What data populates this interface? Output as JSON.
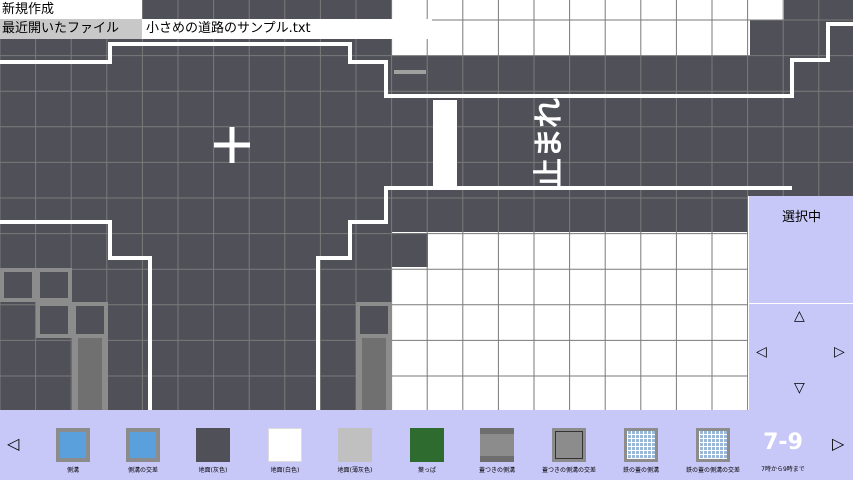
{
  "menu": {
    "new_file": "新規作成",
    "recent_files": "最近開いたファイル",
    "recent_file_name": "小さめの道路のサンプル.txt"
  },
  "map": {
    "road_marking": "止まれ",
    "colors": {
      "road": "#505058",
      "grid": "#7a7a7a",
      "white_line": "#ffffff",
      "ground_white": "#ffffff",
      "gutter": "#8c8c8c"
    }
  },
  "side_panel": {
    "title": "選択中",
    "up": "△",
    "left": "◁",
    "right": "▷",
    "down": "▽"
  },
  "palette": {
    "prev": "◁",
    "next": "▷",
    "items": [
      {
        "label": "側溝",
        "icon": "gutter-icon",
        "color": "#5aa0dc"
      },
      {
        "label": "側溝の交差",
        "icon": "gutter-cross-icon",
        "color": "#5aa0dc"
      },
      {
        "label": "地面(灰色)",
        "icon": "gray-ground-icon",
        "color": "#505058"
      },
      {
        "label": "地面(白色)",
        "icon": "white-ground-icon",
        "color": "#ffffff"
      },
      {
        "label": "地面(薄灰色)",
        "icon": "light-gray-ground-icon",
        "color": "#c0c0c0"
      },
      {
        "label": "葉っぱ",
        "icon": "leaf-icon",
        "color": "#2e6b2e"
      },
      {
        "label": "蓋つきの側溝",
        "icon": "covered-gutter-icon",
        "color": "#8c8c8c"
      },
      {
        "label": "蓋つきの側溝の交差",
        "icon": "covered-gutter-cross-icon",
        "color": "#8c8c8c"
      },
      {
        "label": "鉄の蓋の側溝",
        "icon": "iron-cover-gutter-icon",
        "color": "#9ab8d8"
      },
      {
        "label": "鉄の蓋の側溝の交差",
        "icon": "iron-cover-gutter-cross-icon",
        "color": "#9ab8d8"
      }
    ],
    "time": {
      "value": "7-9",
      "label": "7時から9時まで"
    }
  }
}
